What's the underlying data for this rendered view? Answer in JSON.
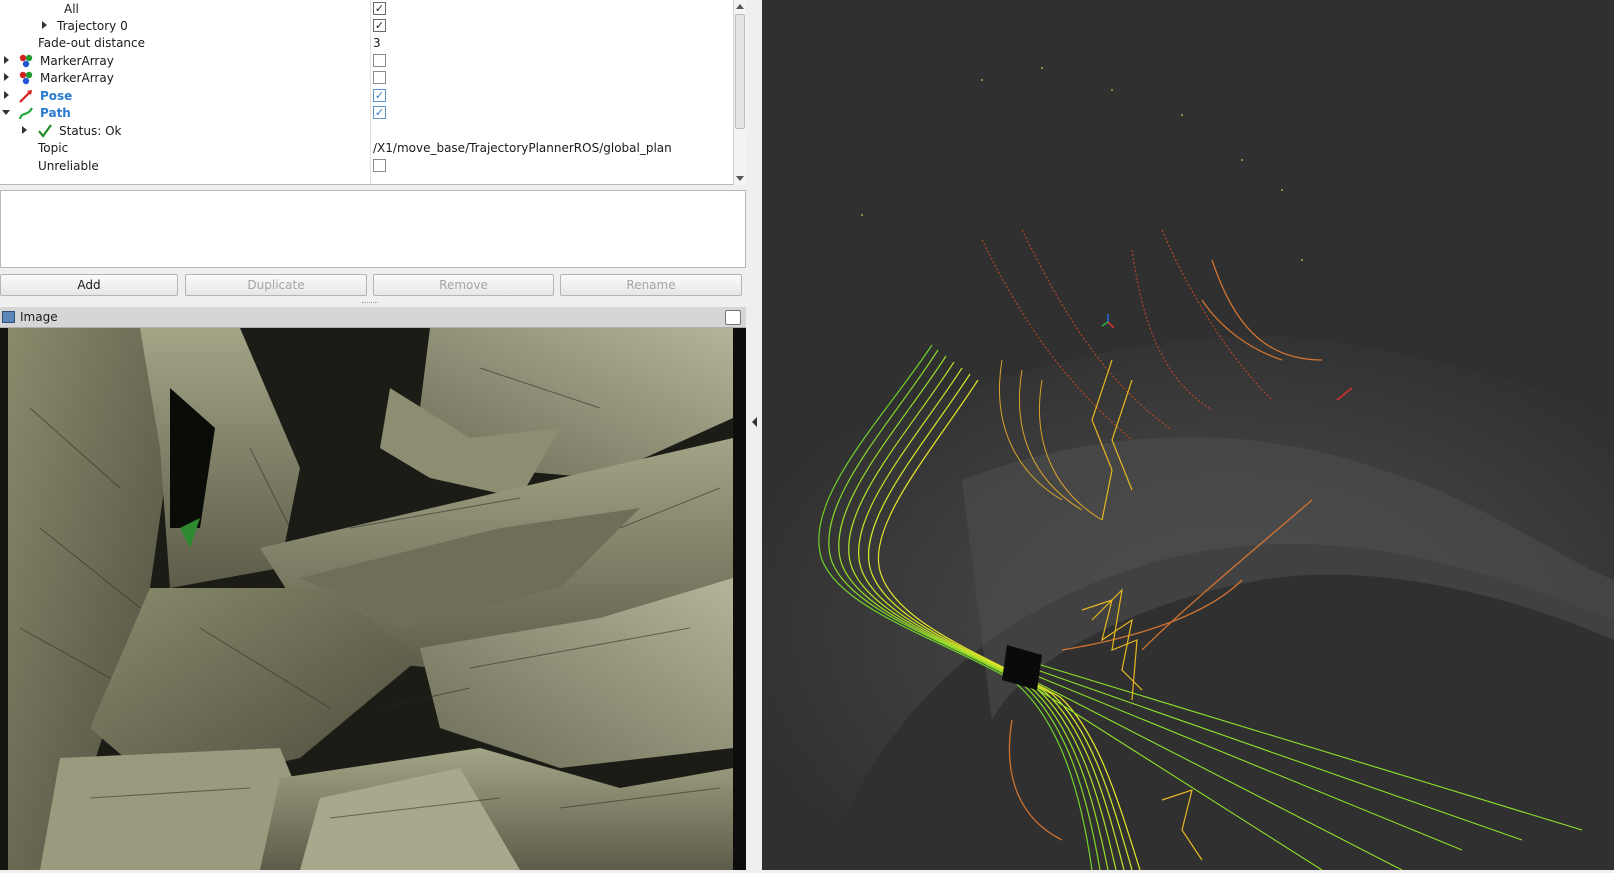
{
  "tree": {
    "rows": [
      {
        "label": "All",
        "value_check": true
      },
      {
        "label": "Trajectory 0",
        "value_check": true
      },
      {
        "label": "Fade-out distance",
        "value_text": "3"
      },
      {
        "label": "MarkerArray",
        "value_check": false
      },
      {
        "label": "MarkerArray",
        "value_check": false
      },
      {
        "label": "Pose",
        "value_check": true
      },
      {
        "label": "Path",
        "value_check": true
      },
      {
        "label": "Status: Ok"
      },
      {
        "label": "Topic",
        "value_text": "/X1/move_base/TrajectoryPlannerROS/global_plan"
      },
      {
        "label": "Unreliable",
        "value_check": false
      }
    ]
  },
  "buttons": {
    "add": "Add",
    "duplicate": "Duplicate",
    "remove": "Remove",
    "rename": "Rename"
  },
  "image_panel": {
    "title": "Image"
  },
  "colors": {
    "accent_blue": "#2a7bd0",
    "view_background": "#303030"
  }
}
